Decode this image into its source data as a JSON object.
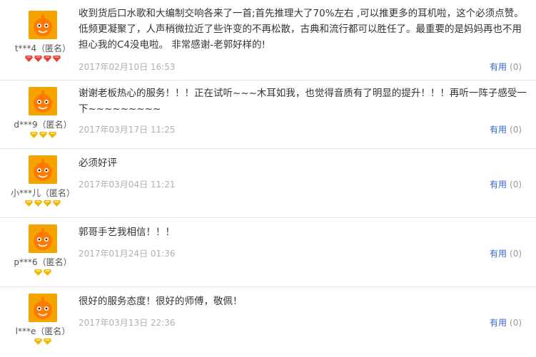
{
  "reviews": [
    {
      "user": "t***4（匿名）",
      "badge_count": 4,
      "badge_color": "#e8413c",
      "content": "收到货后口水歌和大编制交响各来了一首;首先推理大了70%左右 ,可以推更多的耳机啦，这个必须点赞。低频更凝聚了，人声稍微拉近了些许变的不再松散，古典和流行都可以胜任了。最重要的是妈妈再也不用担心我的C4没电啦。 非常感谢-老郭好样的!",
      "date": "2017年02月10日 16:53",
      "useful_label": "有用",
      "useful_count": "(0)"
    },
    {
      "user": "d***9（匿名）",
      "badge_count": 3,
      "badge_color": "#f2b705",
      "content": "谢谢老板热心的服务！！！正在试听~~~木耳如我，也觉得音质有了明显的提升！！！再听一阵子感受一下~~~~~~~~~",
      "date": "2017年03月17日 11:25",
      "useful_label": "有用",
      "useful_count": "(0)"
    },
    {
      "user": "小***儿（匿名）",
      "badge_count": 4,
      "badge_color": "#f2b705",
      "content": "必须好评",
      "date": "2017年03月04日 11:21",
      "useful_label": "有用",
      "useful_count": "(0)"
    },
    {
      "user": "p***6（匿名）",
      "badge_count": 2,
      "badge_color": "#f2b705",
      "content": "郭哥手艺我相信！！！",
      "date": "2017年01月24日 01:36",
      "useful_label": "有用",
      "useful_count": "(0)"
    },
    {
      "user": "l***e（匿名）",
      "badge_count": 2,
      "badge_color": "#f2b705",
      "content": "很好的服务态度！很好的师傅，敬佩！",
      "date": "2017年03月13日 22:36",
      "useful_label": "有用",
      "useful_count": "(0)"
    }
  ]
}
